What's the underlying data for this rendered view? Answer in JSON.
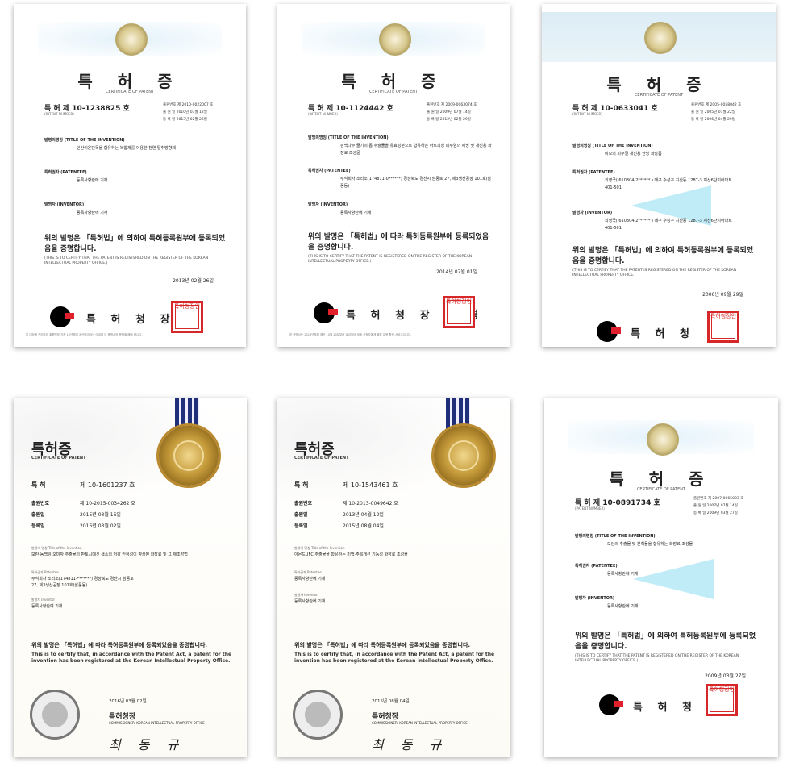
{
  "certificates": [
    {
      "title": "특 허 증",
      "subtitle": "CERTIFICATE OF PATENT",
      "number": "특 허   제 10-1238825 호",
      "number_label": "(PATENT NUMBER)",
      "meta": [
        "출원번호   제 2010-0022007 호",
        "출 원 일   2010년 03월 12일",
        "등 록 일   2013년 02월 26일"
      ],
      "invention_label": "발명의명칭 (TITLE OF THE INVENTION)",
      "invention": "인산이온단독을 함유하는 복합제를 이용한 천연 탈취방향제",
      "owner_label": "특허권자 (PATENTEE)",
      "owner": "등록사항란에 기재",
      "inventor_label": "발명자 (INVENTOR)",
      "inventor": "등록사항란에 기재",
      "statement": "위의 발명은 「특허법」에 의하여 특허등록원부에 등록되었음을 증명합니다.",
      "statement_en": "(THIS IS TO CERTIFY THAT THE PATENT IS REGISTERED ON THE REGISTER OF THE KOREAN INTELLECTUAL PROPERTY OFFICE.)",
      "date": "2013년   02월   26일",
      "agency": "특 허 청 장",
      "stamp": "특허청장인",
      "footer": "본 대장에 관리하여 출원번호 기준 10년부터 계산하여 5년 이내에 이 증명서의 복원을 해야 합니다."
    },
    {
      "title": "특 허 증",
      "subtitle": "CERTIFICATE OF PATENT",
      "number": "특 허   제 10-1124442 호",
      "number_label": "(PATENT NUMBER)",
      "meta": [
        "출원번호   제 2009-0063074 호",
        "출 원 일   2009년 07월 14일",
        "등 록 일   2012년 02월 29일"
      ],
      "invention_label": "발명의명칭 (TITLE OF THE INVENTION)",
      "invention": "편백나무 줄기의 톱 추출물을 유효성분으로 함유하는 아토피성 피부염의 예방 및 개선용 화장료 조성물",
      "owner_label": "특허권자 (PATENTEE)",
      "owner": "주식회사 소리소(174811-0******) 경상북도 경산시 삼풍로 27, 제3생산공장 101호(삼풍동)",
      "inventor_label": "발명자 (INVENTOR)",
      "inventor": "등록사항란에 기재",
      "statement": "위의 발명은 「특허법」에 따라 특허등록원부에 등록되었음을 증명합니다.",
      "statement_en": "(THIS IS TO CERTIFY THAT THE PATENT IS REGISTERED ON THE REGISTER OF THE KOREAN INTELLECTUAL PROPERTY OFFICE.)",
      "date": "2014년   07월   01일",
      "agency": "특 허 청 장  김 영",
      "stamp": "특허청장인",
      "footer": "본 증명서는 2013년부터 예산 10월 20일부터 발급되어 세계 신청자에게 빠른 대응 향상 서비스입니다."
    },
    {
      "title": "특 허 증",
      "subtitle": "CERTIFICATE OF PATENT",
      "number": "특 허   제 10-0633041 호",
      "number_label": "(PATENT NUMBER)",
      "meta": [
        "출원번호   제 2005-0058042 호",
        "출 원 일   2005년 01월 22일",
        "등 록 일   2006년 04월 29일"
      ],
      "invention_label": "발명의명칭 (TITLE OF THE INVENTION)",
      "invention": "미모의 피부결 개선용 한방 화장품",
      "owner_label": "특허권자 (PATENTEE)",
      "owner": "최영국( 610304-2****** )  대구 수성구 지산동 1287-3 지산6단지아파트 401-501",
      "inventor_label": "발명자 (INVENTOR)",
      "inventor": "최영국( 610304-2****** )  대구 수성구 지산동 1287-3 지산6단지아파트 401-501",
      "statement": "위의 발명은 「특허법」에 의하여 특허등록원부에 등록되었음을 증명합니다.",
      "statement_en": "(THIS IS TO CERTIFY THAT THE PATENT IS REGISTERED ON THE REGISTER OF THE KOREAN INTELLECTUAL PROPERTY OFFICE.)",
      "date": "2006년   09월   29일",
      "agency": "특 허 청",
      "stamp": "특허청장인"
    },
    {
      "title": "특허증",
      "subtitle": "CERTIFICATE OF PATENT",
      "rows": [
        {
          "k": "특 허",
          "v": "제 10-1601237 호"
        },
        {
          "k": "출원번호",
          "v": "제 10-2015-0034262 호"
        },
        {
          "k": "출원일",
          "v": "2015년 03월 16일"
        },
        {
          "k": "등록일",
          "v": "2016년 03월 02일"
        }
      ],
      "invention_label": "발명의 명칭 Title of the Invention",
      "invention": "모란·동백잎·오미자 추출물의 판토시메신 색소의 저감 안정성이 향상된 화장료 및 그 제조방법",
      "owner_label": "특허권자 Patentee",
      "owner": "주식회사 소리소(174811-*******) 경상북도 경산시 삼풍로 27, 제3생산공장 101호(삼풍동)",
      "inventor_label": "발명자 Inventor",
      "inventor": "등록사항란에 기재",
      "statement": "위의 발명은 「특허법」에 따라 특허등록원부에 등록되었음을 증명합니다.",
      "statement_en": "This is to certify that, in accordance with the Patent Act, a patent for the invention has been registered at the Korean Intellectual Property Office.",
      "date": "2016년 03월 02일",
      "agency": "특허청장",
      "commissioner": "COMMISSIONER, KOREAN INTELLECTUAL PROPERTY OFFICE",
      "signature": "최 동 규"
    },
    {
      "title": "특허증",
      "subtitle": "CERTIFICATE OF PATENT",
      "rows": [
        {
          "k": "특 허",
          "v": "제 10-1543461 호"
        },
        {
          "k": "출원번호",
          "v": "제 10-2013-0049642 호"
        },
        {
          "k": "출원일",
          "v": "2013년 04월 12일"
        },
        {
          "k": "등록일",
          "v": "2015년 08월 04일"
        }
      ],
      "invention_label": "발명의 명칭 Title of the Invention",
      "invention": "아몬드UFC 추출물을 함유하는 미백·주름개선 기능성 화장료 조성물",
      "owner_label": "특허권자 Patentee",
      "owner": "등록사항란에 기재",
      "inventor_label": "발명자 Inventor",
      "inventor": "등록사항란에 기재",
      "statement": "위의 발명은 「특허법」에 따라 특허등록원부에 등록되었음을 증명합니다.",
      "statement_en": "This is to certify that, in accordance with the Patent Act, a patent for the invention has been registered at the Korean Intellectual Property Office.",
      "date": "2015년 08월 04일",
      "agency": "특허청장",
      "commissioner": "COMMISSIONER, KOREAN INTELLECTUAL PROPERTY OFFICE",
      "signature": "최 동 규"
    },
    {
      "title": "특 허 증",
      "subtitle": "CERTIFICATE OF PATENT",
      "number": "특 허   제 10-0891734 호",
      "number_label": "(PATENT NUMBER)",
      "meta": [
        "출원번호   제 2007-0065003 호",
        "출 원 일   2007년 07월 14일",
        "등 록 일   2009년 03월 27일"
      ],
      "invention_label": "발명의명칭 (TITLE OF THE INVENTION)",
      "invention": "도인의 추출물 및 분획물을 함유하는 화장료 조성물",
      "owner_label": "특허권자 (PATENTEE)",
      "owner": "등록사항란에 기재",
      "inventor_label": "발명자 (INVENTOR)",
      "inventor": "등록사항란에 기재",
      "statement": "위의 발명은 「특허법」에 의하여 특허등록원부에 등록되었음을 증명합니다.",
      "statement_en": "(THIS IS TO CERTIFY THAT THE PATENT IS REGISTERED ON THE REGISTER OF THE KOREAN INTELLECTUAL PROPERTY OFFICE.)",
      "date": "2009년   03월   27일",
      "agency": "특 허 청",
      "stamp": "특허청장인"
    }
  ]
}
